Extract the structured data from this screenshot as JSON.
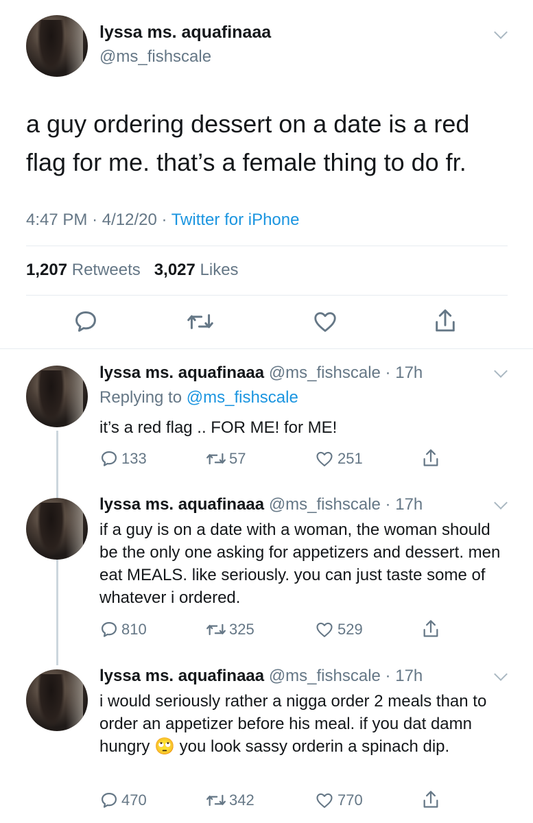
{
  "main_tweet": {
    "display_name": "lyssa ms. aquafinaaa",
    "handle": "@ms_fishscale",
    "text": "a guy ordering dessert on a date is a red flag for me. that’s a female thing to do fr.",
    "time": "4:47 PM",
    "date": "4/12/20",
    "source": "Twitter for iPhone",
    "sep": "·",
    "retweets_count": "1,207",
    "retweets_label": "Retweets",
    "likes_count": "3,027",
    "likes_label": "Likes"
  },
  "replies": [
    {
      "display_name": "lyssa ms. aquafinaaa",
      "meta": "@ms_fishscale · 17h",
      "replying_prefix": "Replying to",
      "replying_to": "@ms_fishscale",
      "text": "it’s a red flag .. FOR ME! for ME!",
      "reply_count": "133",
      "retweet_count": "57",
      "like_count": "251"
    },
    {
      "display_name": "lyssa ms. aquafinaaa",
      "meta": "@ms_fishscale · 17h",
      "text": "if a guy is on a date with a woman, the woman should be the only one asking for appetizers and dessert. men eat MEALS. like seriously. you can just taste some of whatever i ordered.",
      "reply_count": "810",
      "retweet_count": "325",
      "like_count": "529"
    },
    {
      "display_name": "lyssa ms. aquafinaaa",
      "meta": "@ms_fishscale · 17h",
      "text_before": "i would seriously rather a nigga order 2 meals than to order an appetizer before his meal. if you dat damn hungry",
      "emoji": "🙄",
      "text_after": "you look sassy orderin a spinach dip.",
      "reply_count": "470",
      "retweet_count": "342",
      "like_count": "770"
    }
  ],
  "icons": {
    "reply": "speech-bubble-icon",
    "retweet": "retweet-arrows-icon",
    "like": "heart-icon",
    "share": "share-upload-icon",
    "more": "chevron-down-icon"
  },
  "colors": {
    "link": "#1b95e0",
    "muted": "#657786",
    "text": "#14171a",
    "divider": "#e6ecf0"
  }
}
